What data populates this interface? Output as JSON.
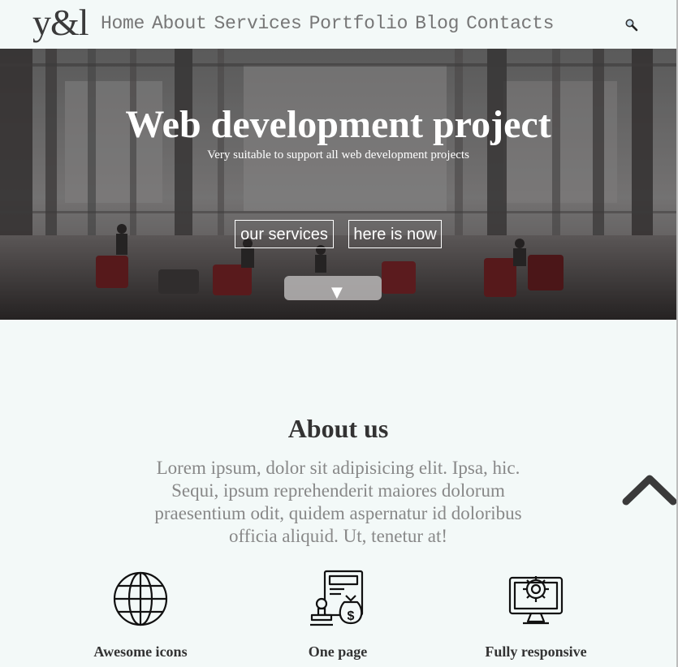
{
  "header": {
    "logo": "y&l",
    "nav": [
      "Home",
      "About",
      "Services",
      "Portfolio",
      "Blog",
      "Contacts"
    ],
    "search_icon": "search-icon"
  },
  "hero": {
    "title": "Web development project",
    "subtitle": "Very suitable to support all web development projects",
    "buttons": [
      "our services",
      "here is now"
    ],
    "scroll_down_icon": "▼"
  },
  "about": {
    "title": "About us",
    "text": "Lorem ipsum, dolor sit adipisicing elit. Ipsa, hic. Sequi, ipsum reprehenderit maiores dolorum praesentium odit, quidem aspernatur id doloribus officia aliquid. Ut, tenetur at!",
    "features": [
      {
        "label": "Awesome icons",
        "icon": "globe-icon"
      },
      {
        "label": "One page",
        "icon": "money-bag-stamp-icon"
      },
      {
        "label": "Fully responsive",
        "icon": "monitor-gear-icon"
      }
    ]
  },
  "back_to_top_icon": "chevron-up-icon"
}
